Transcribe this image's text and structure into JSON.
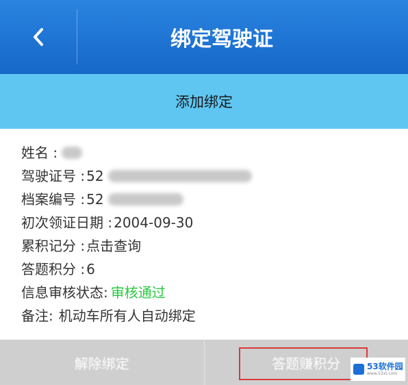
{
  "header": {
    "title": "绑定驾驶证"
  },
  "subbar": {
    "label": "添加绑定"
  },
  "info": {
    "name_label": "姓名 :",
    "license_label": "驾驶证号 :",
    "license_prefix": "52",
    "file_label": "档案编号 :",
    "file_prefix": "52",
    "issue_date_label": "初次领证日期 :",
    "issue_date_value": "2004-09-30",
    "points_label": "累积记分 :",
    "points_value": "点击查询",
    "quiz_label": "答题积分 :",
    "quiz_value": "6",
    "status_label": "信息审核状态:",
    "status_value": "审核通过",
    "remark_label": "备注:",
    "remark_value": "机动车所有人自动绑定"
  },
  "bottom": {
    "unbind_label": "解除绑定",
    "answer_label": "答题赚积分"
  },
  "watermark": {
    "title": "53软件园",
    "sub": "www.53xt.com"
  },
  "colors": {
    "header": "#1f74d6",
    "subbar": "#5fc6f2",
    "status_green": "#27c93f",
    "highlight": "#d93a3a"
  }
}
